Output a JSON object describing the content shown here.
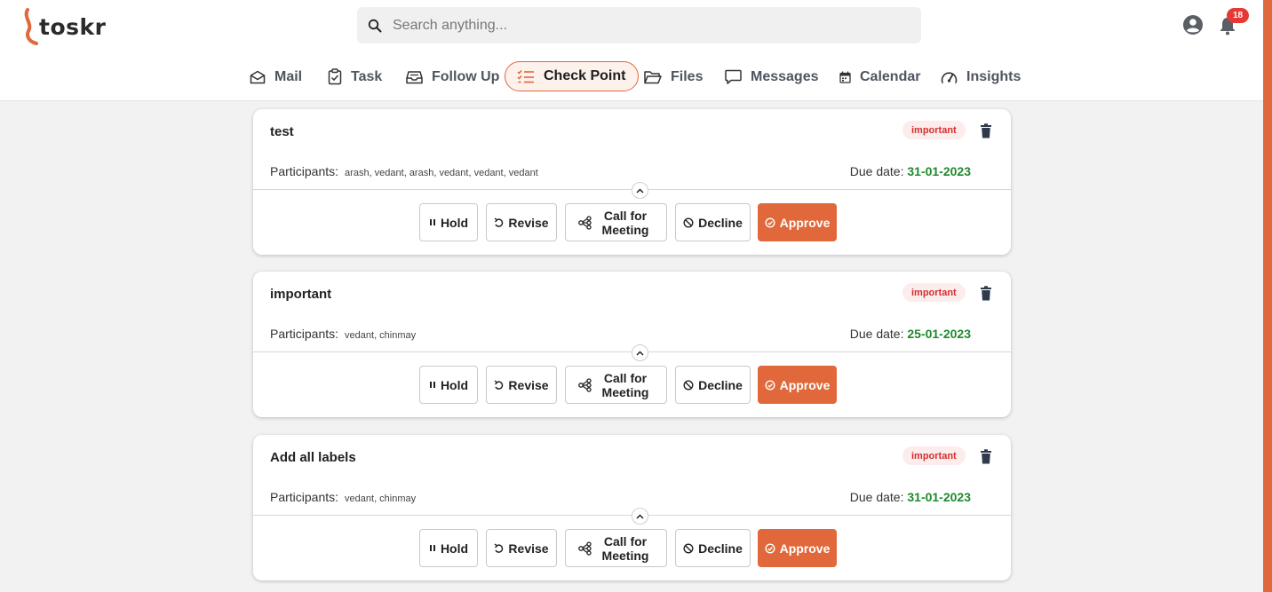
{
  "app": {
    "logo_text": "toskr"
  },
  "search": {
    "placeholder": "Search anything..."
  },
  "notifications": {
    "count": "18"
  },
  "nav": {
    "items": [
      {
        "label": "Mail",
        "icon": "mail-icon"
      },
      {
        "label": "Task",
        "icon": "clipboard-icon"
      },
      {
        "label": "Follow Up",
        "icon": "inbox-icon"
      },
      {
        "label": "Check Point",
        "icon": "checklist-icon",
        "active": true
      },
      {
        "label": "Files",
        "icon": "folder-icon"
      },
      {
        "label": "Messages",
        "icon": "chat-icon"
      },
      {
        "label": "Calendar",
        "icon": "calendar-icon"
      },
      {
        "label": "Insights",
        "icon": "gauge-icon"
      }
    ]
  },
  "labels": {
    "participants": "Participants:",
    "due_date": "Due date:",
    "hold": "Hold",
    "revise": "Revise",
    "call_for": "Call for",
    "meeting": "Meeting",
    "decline": "Decline",
    "approve": "Approve"
  },
  "checkpoints": [
    {
      "title": "test",
      "tag": "important",
      "participants": "arash, vedant, arash, vedant, vedant, vedant",
      "due_date": "31-01-2023"
    },
    {
      "title": "important",
      "tag": "important",
      "participants": "vedant, chinmay",
      "due_date": "25-01-2023"
    },
    {
      "title": "Add all labels",
      "tag": "important",
      "participants": "vedant, chinmay",
      "due_date": "31-01-2023"
    }
  ],
  "colors": {
    "accent": "#e0683a",
    "tag_text": "#d32f2f",
    "tag_bg": "#fdecec",
    "due_date": "#1e8a2c",
    "badge": "#e53935"
  }
}
